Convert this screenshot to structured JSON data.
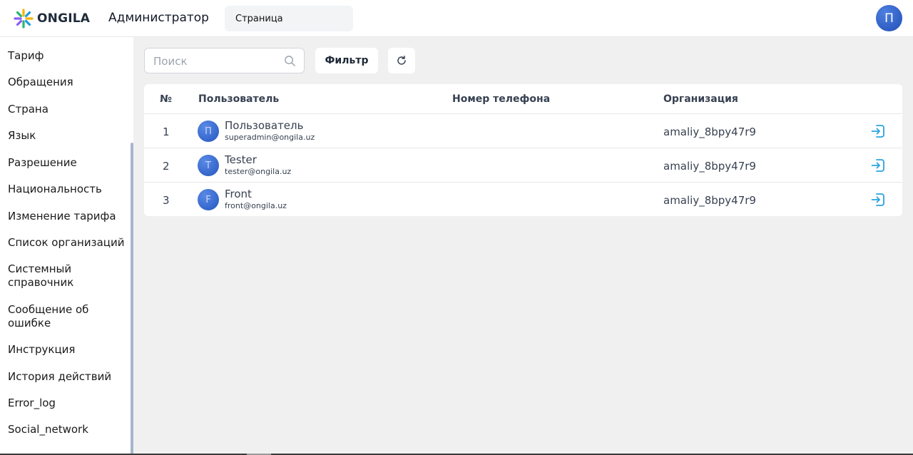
{
  "header": {
    "brand": "ONGILA",
    "role": "Администратор",
    "page_select": "Страница",
    "user_initial": "П"
  },
  "sidebar": {
    "items": [
      {
        "label": "Тариф"
      },
      {
        "label": "Обращения"
      },
      {
        "label": "Страна"
      },
      {
        "label": "Язык"
      },
      {
        "label": "Разрешение"
      },
      {
        "label": "Национальность"
      },
      {
        "label": "Изменение тарифа"
      },
      {
        "label": "Список организаций"
      },
      {
        "label": "Системный справочник"
      },
      {
        "label": "Сообщение об ошибке"
      },
      {
        "label": "Инструкция"
      },
      {
        "label": "История действий"
      },
      {
        "label": "Error_log"
      },
      {
        "label": "Social_network"
      }
    ]
  },
  "toolbar": {
    "search_placeholder": "Поиск",
    "filter_label": "Фильтр"
  },
  "table": {
    "columns": [
      "№",
      "Пользователь",
      "Номер телефона",
      "Организация"
    ],
    "rows": [
      {
        "num": "1",
        "initial": "П",
        "name": "Пользователь",
        "email": "superadmin@ongila.uz",
        "phone": "",
        "org": "amaliy_8bpy47r9"
      },
      {
        "num": "2",
        "initial": "T",
        "name": "Tester",
        "email": "tester@ongila.uz",
        "phone": "",
        "org": "amaliy_8bpy47r9"
      },
      {
        "num": "3",
        "initial": "F",
        "name": "Front",
        "email": "front@ongila.uz",
        "phone": "",
        "org": "amaliy_8bpy47r9"
      }
    ]
  },
  "icons": {
    "logo": "ongila-star-logo",
    "search": "search-icon",
    "refresh": "refresh-icon",
    "row_action": "login-icon"
  },
  "colors": {
    "accent": "#2aa3e0",
    "avatar": "#2456bf",
    "background": "#f0f0f0"
  }
}
